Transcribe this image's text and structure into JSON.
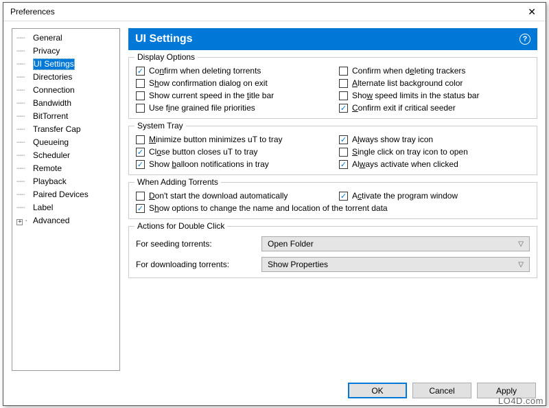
{
  "window": {
    "title": "Preferences",
    "close": "✕"
  },
  "sidebar": {
    "items": [
      {
        "label": "General",
        "selected": false,
        "expand": null
      },
      {
        "label": "Privacy",
        "selected": false,
        "expand": null
      },
      {
        "label": "UI Settings",
        "selected": true,
        "expand": null
      },
      {
        "label": "Directories",
        "selected": false,
        "expand": null
      },
      {
        "label": "Connection",
        "selected": false,
        "expand": null
      },
      {
        "label": "Bandwidth",
        "selected": false,
        "expand": null
      },
      {
        "label": "BitTorrent",
        "selected": false,
        "expand": null
      },
      {
        "label": "Transfer Cap",
        "selected": false,
        "expand": null
      },
      {
        "label": "Queueing",
        "selected": false,
        "expand": null
      },
      {
        "label": "Scheduler",
        "selected": false,
        "expand": null
      },
      {
        "label": "Remote",
        "selected": false,
        "expand": null
      },
      {
        "label": "Playback",
        "selected": false,
        "expand": null
      },
      {
        "label": "Paired Devices",
        "selected": false,
        "expand": null
      },
      {
        "label": "Label",
        "selected": false,
        "expand": null
      },
      {
        "label": "Advanced",
        "selected": false,
        "expand": "+"
      }
    ]
  },
  "banner": {
    "title": "UI Settings",
    "help": "?"
  },
  "groups": {
    "display": {
      "legend": "Display Options",
      "items": [
        {
          "checked": true,
          "pre": "Co",
          "u": "n",
          "post": "firm when deleting torrents"
        },
        {
          "checked": false,
          "pre": "Confirm when d",
          "u": "e",
          "post": "leting trackers"
        },
        {
          "checked": false,
          "pre": "S",
          "u": "h",
          "post": "ow confirmation dialog on exit"
        },
        {
          "checked": false,
          "pre": "",
          "u": "A",
          "post": "lternate list background color"
        },
        {
          "checked": false,
          "pre": "Show current speed in the ",
          "u": "t",
          "post": "itle bar"
        },
        {
          "checked": false,
          "pre": "Sho",
          "u": "w",
          "post": " speed limits in the status bar"
        },
        {
          "checked": false,
          "pre": "Use f",
          "u": "i",
          "post": "ne grained file priorities"
        },
        {
          "checked": true,
          "pre": "",
          "u": "C",
          "post": "onfirm exit if critical seeder"
        }
      ]
    },
    "tray": {
      "legend": "System Tray",
      "items": [
        {
          "checked": false,
          "pre": "",
          "u": "M",
          "post": "inimize button minimizes uT to tray"
        },
        {
          "checked": true,
          "pre": "A",
          "u": "l",
          "post": "ways show tray icon"
        },
        {
          "checked": true,
          "pre": "Cl",
          "u": "o",
          "post": "se button closes uT to tray"
        },
        {
          "checked": false,
          "pre": "",
          "u": "S",
          "post": "ingle click on tray icon to open"
        },
        {
          "checked": true,
          "pre": "Show ",
          "u": "b",
          "post": "alloon notifications in tray"
        },
        {
          "checked": true,
          "pre": "Al",
          "u": "w",
          "post": "ays activate when clicked"
        }
      ]
    },
    "adding": {
      "legend": "When Adding Torrents",
      "items": [
        {
          "checked": false,
          "pre": "",
          "u": "D",
          "post": "on't start the download automatically"
        },
        {
          "checked": true,
          "pre": "A",
          "u": "c",
          "post": "tivate the program window"
        },
        {
          "checked": true,
          "pre": "S",
          "u": "h",
          "post": "ow options to change the name and location of the torrent data",
          "full": true
        }
      ]
    },
    "actions": {
      "legend": "Actions for Double Click",
      "seeding_label": "For seeding torrents:",
      "seeding_value": "Open Folder",
      "download_label": "For downloading torrents:",
      "download_value": "Show Properties"
    }
  },
  "footer": {
    "ok": "OK",
    "cancel": "Cancel",
    "apply": "Apply"
  },
  "watermark": "LO4D.com"
}
